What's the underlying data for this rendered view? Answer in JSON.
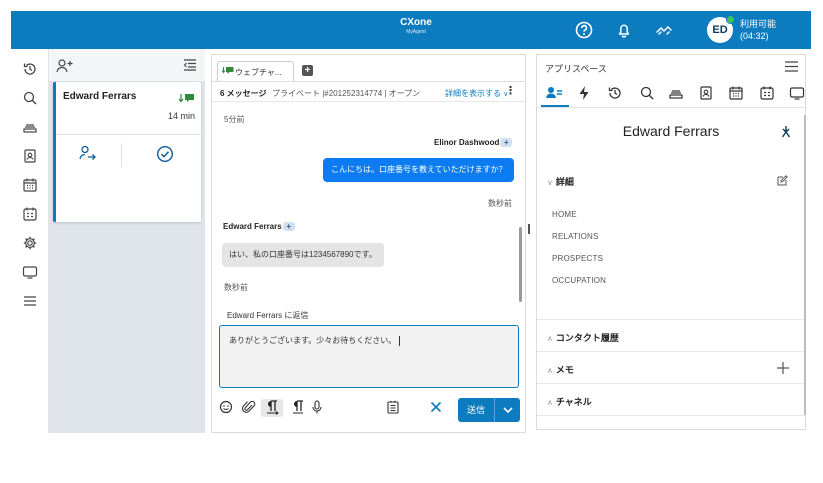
{
  "topbar": {
    "brand_line1": "CXone",
    "brand_line2": "MyAgent",
    "icons": [
      "help-icon",
      "bell-icon",
      "connection-icon"
    ],
    "avatar_initials": "ED",
    "status_label": "利用可能",
    "status_timer": "(04:32)"
  },
  "leftnav": {
    "icons": [
      "history-icon",
      "search-icon",
      "queue-icon",
      "contacts-icon",
      "calendar-icon",
      "schedule-icon",
      "settings-icon",
      "monitor-icon",
      "menu-icon"
    ]
  },
  "conversation_list": {
    "card": {
      "name": "Edward Ferrars",
      "elapsed": "14 min"
    }
  },
  "chat": {
    "tab_label": "ウェブチャ...",
    "message_count": "6 メッセージ",
    "info": "プライベート |#201252314774 | オープン",
    "details_link": "詳細を表示する",
    "time1": "5分前",
    "agent_name": "Elinor Dashwood",
    "agent_message": "こんにちは。口座番号を教えていただけますか？",
    "time2": "数秒前",
    "customer_name": "Edward Ferrars",
    "customer_message": "はい、私の口座番号は1234567890です。",
    "time3": "数秒前",
    "reply_to": "Edward Ferrars に返信",
    "reply_text": "ありがとうございます。少々お待ちください。",
    "send_label": "送信"
  },
  "appspace": {
    "title": "アプリスペース",
    "contact_name": "Edward Ferrars",
    "details_header": "詳細",
    "details_items": [
      "HOME",
      "RELATIONS",
      "PROSPECTS",
      "OCCUPATION"
    ],
    "sections": [
      "コンタクト履歴",
      "メモ",
      "チャネル"
    ]
  },
  "colors": {
    "brand_blue": "#0d7cbf",
    "bubble_blue": "#0d7cf2",
    "available_green": "#3ec35a",
    "chat_icon_green": "#2e8b3a"
  }
}
